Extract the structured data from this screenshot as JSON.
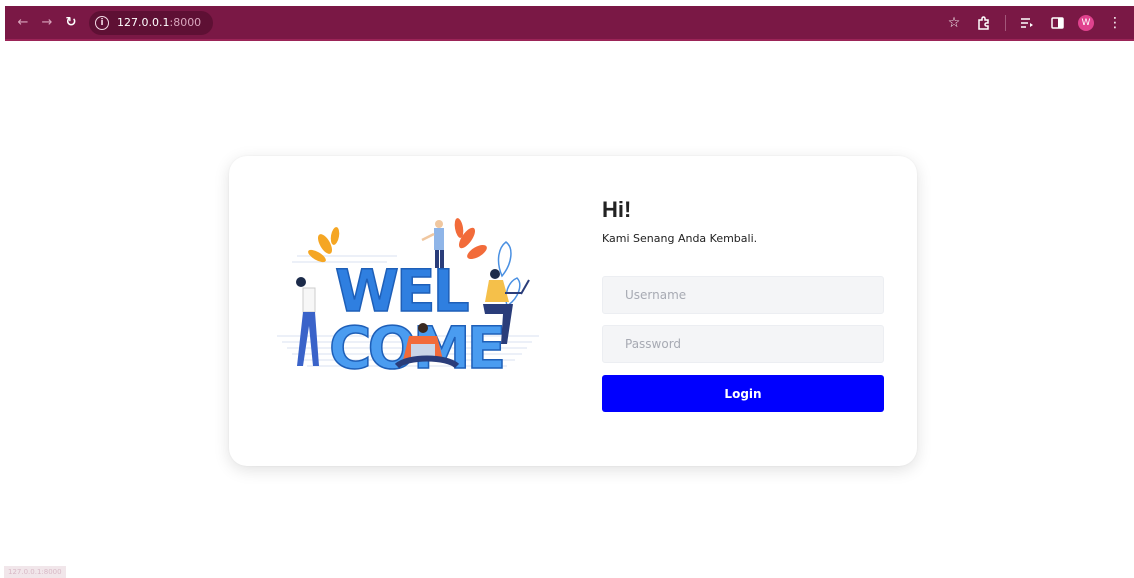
{
  "browser": {
    "url_host": "127.0.0.1",
    "url_port": ":8000",
    "profile_initial": "W",
    "status_url": "127.0.0.1:8000"
  },
  "icons": {
    "back": "arrow-left-icon",
    "forward": "arrow-right-icon",
    "reload": "reload-icon",
    "site_info": "info-icon",
    "bookmark": "star-icon",
    "extensions": "puzzle-icon",
    "reading_list": "reading-list-icon",
    "side_panel": "side-panel-icon",
    "menu": "kebab-menu-icon"
  },
  "colors": {
    "browser_bar": "#7a1845",
    "login_button": "#0000ff",
    "input_bg": "#f4f5f7"
  },
  "login": {
    "greeting": "Hi!",
    "subtitle": "Kami Senang Anda Kembali.",
    "username_placeholder": "Username",
    "password_placeholder": "Password",
    "button_label": "Login"
  },
  "illustration": {
    "word_line1": "WEL",
    "word_line2": "COME"
  }
}
